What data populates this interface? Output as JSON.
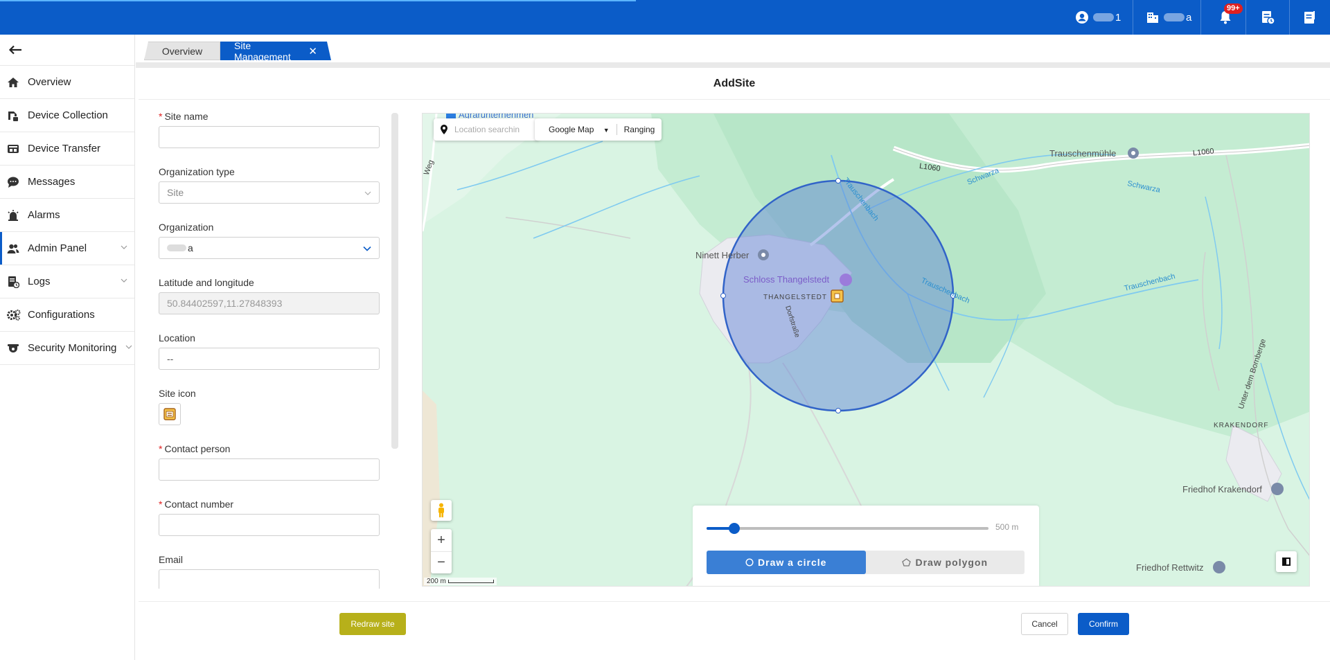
{
  "topbar": {
    "user_suffix": "1",
    "org_suffix": "a",
    "badge": "99+"
  },
  "sidebar": {
    "items": [
      {
        "label": "Overview"
      },
      {
        "label": "Device Collection"
      },
      {
        "label": "Device Transfer"
      },
      {
        "label": "Messages"
      },
      {
        "label": "Alarms"
      },
      {
        "label": "Admin Panel"
      },
      {
        "label": "Logs"
      },
      {
        "label": "Configurations"
      },
      {
        "label": "Security Monitoring"
      }
    ]
  },
  "tabs": {
    "overview": "Overview",
    "site_management": "Site Management",
    "close": "✕"
  },
  "page": {
    "title": "AddSite"
  },
  "form": {
    "site_name": {
      "label": "Site name",
      "value": ""
    },
    "org_type": {
      "label": "Organization type",
      "value": "Site"
    },
    "organization": {
      "label": "Organization",
      "value": "a"
    },
    "latlng": {
      "label": "Latitude and longitude",
      "value": "50.84402597,11.27848393"
    },
    "location": {
      "label": "Location",
      "value": "--"
    },
    "site_icon": {
      "label": "Site icon"
    },
    "contact_person": {
      "label": "Contact person",
      "value": ""
    },
    "contact_number": {
      "label": "Contact number",
      "value": ""
    },
    "email": {
      "label": "Email",
      "value": ""
    }
  },
  "map": {
    "search_placeholder": "Location searchin",
    "map_type": "Google Map",
    "ranging": "Ranging",
    "scale_label": "200 m",
    "labels": {
      "agrar": "Agrarunternehmen",
      "trauschenmuhle": "Trauschenmühle",
      "l1060_a": "L1060",
      "l1060_b": "L1060",
      "schwarza_a": "Schwarza",
      "schwarza_b": "Schwarza",
      "trauschenbach_a": "Trauschenbach",
      "trauschenbach_b": "Trauschenbach",
      "trauschenbach_c": "Trauschenbach",
      "ninett": "Ninett Herber",
      "schloss": "Schloss Thangelstedt",
      "thangelstedt": "THANGELSTEDT",
      "dorfstrasse": "Dorfstraße",
      "weg": "Weg",
      "krakendorf": "KRAKENDORF",
      "friedhof_k": "Friedhof Krakendorf",
      "friedhof_r": "Friedhof Rettwitz",
      "bornberge": "Unter dem Bornberge"
    },
    "radius": {
      "value": 500,
      "max": 10000,
      "label": "500 m"
    },
    "draw_circle": "Draw a circle",
    "draw_polygon": "Draw polygon"
  },
  "footer": {
    "redraw": "Redraw site",
    "cancel": "Cancel",
    "confirm": "Confirm"
  }
}
